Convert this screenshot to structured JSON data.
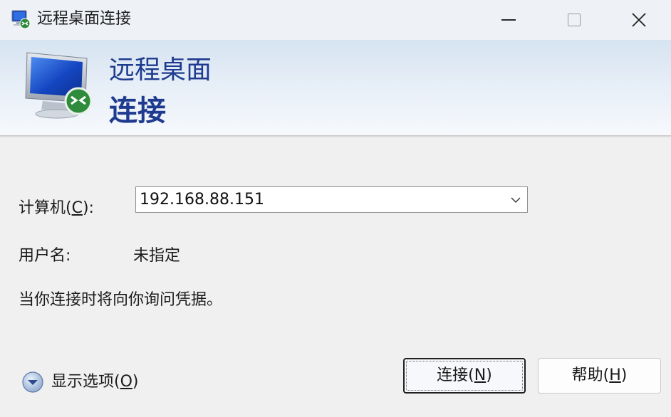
{
  "window": {
    "title": "远程桌面连接",
    "controls": {
      "minimize": "minimize",
      "maximize": "maximize",
      "close": "close"
    }
  },
  "banner": {
    "line1": "远程桌面",
    "line2": "连接"
  },
  "form": {
    "computer_label_prefix": "计算机(",
    "computer_label_key": "C",
    "computer_label_suffix": "):",
    "computer_value": "192.168.88.151",
    "username_label": "用户名:",
    "username_value": "未指定",
    "info_text": "当你连接时将向你询问凭据。"
  },
  "options": {
    "label_prefix": "显示选项(",
    "label_key": "O",
    "label_suffix": ")"
  },
  "buttons": {
    "connect_prefix": "连接(",
    "connect_key": "N",
    "connect_suffix": ")",
    "help_prefix": "帮助(",
    "help_key": "H",
    "help_suffix": ")"
  },
  "icons": {
    "app": "remote-desktop-icon",
    "banner": "monitor-connection-icon",
    "dropdown": "chevron-down-icon",
    "options": "expand-circle-icon"
  },
  "colors": {
    "accent": "#1e3b8f",
    "background": "#f0f0f0",
    "banner_top": "#d6e3f1"
  }
}
